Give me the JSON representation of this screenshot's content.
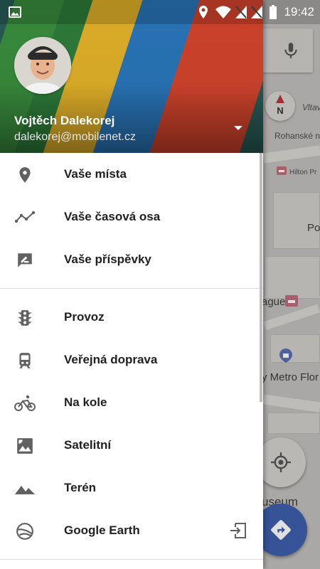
{
  "status_bar": {
    "time": "19:42"
  },
  "user": {
    "name": "Vojtěch Dalekorej",
    "email": "dalekorej@mobilenet.cz"
  },
  "menu": {
    "section1": [
      {
        "label": "Vaše místa",
        "icon": "place-pin-icon"
      },
      {
        "label": "Vaše časová osa",
        "icon": "timeline-icon"
      },
      {
        "label": "Vaše příspěvky",
        "icon": "contributions-icon"
      }
    ],
    "section2": [
      {
        "label": "Provoz",
        "icon": "traffic-icon"
      },
      {
        "label": "Veřejná doprava",
        "icon": "train-icon"
      },
      {
        "label": "Na kole",
        "icon": "bike-icon"
      },
      {
        "label": "Satelitní",
        "icon": "satellite-icon"
      },
      {
        "label": "Terén",
        "icon": "terrain-icon"
      },
      {
        "label": "Google Earth",
        "icon": "earth-icon"
      }
    ]
  },
  "map": {
    "labels": {
      "vlt": "Vltav",
      "rohanske": "Rohanské n",
      "hilton": "Hilton Pr",
      "po": "Po",
      "ague": "ague",
      "metro": "y Metro Flor",
      "museum": "useum"
    },
    "compass_letter": "N"
  },
  "colors": {
    "accent": "#3d5fab",
    "stripe_green": "#3a8f3f",
    "stripe_yellow": "#e7b52a",
    "stripe_blue": "#2a78bd",
    "stripe_red": "#d6452d"
  }
}
